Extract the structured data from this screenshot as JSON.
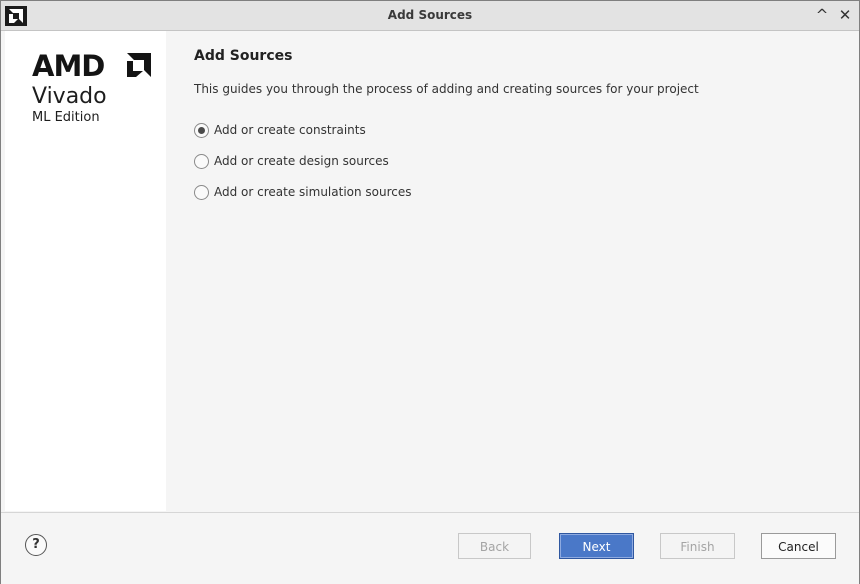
{
  "window": {
    "title": "Add Sources"
  },
  "sidebar": {
    "brand": "AMD",
    "product": "Vivado",
    "edition": "ML Edition"
  },
  "main": {
    "heading": "Add Sources",
    "description": "This guides you through the process of adding and creating sources for your project",
    "options": [
      {
        "label": "Add or create constraints",
        "selected": true
      },
      {
        "label": "Add or create design sources",
        "selected": false
      },
      {
        "label": "Add or create simulation sources",
        "selected": false
      }
    ]
  },
  "footer": {
    "help": "?",
    "back": "Back",
    "next": "Next",
    "finish": "Finish",
    "cancel": "Cancel"
  },
  "colors": {
    "primary_button": "#4a78c8",
    "sidebar_bg": "#ffffff",
    "window_bg": "#f5f5f5"
  },
  "icons": [
    "amd-logo-icon",
    "minimize-icon",
    "close-icon",
    "help-icon"
  ]
}
